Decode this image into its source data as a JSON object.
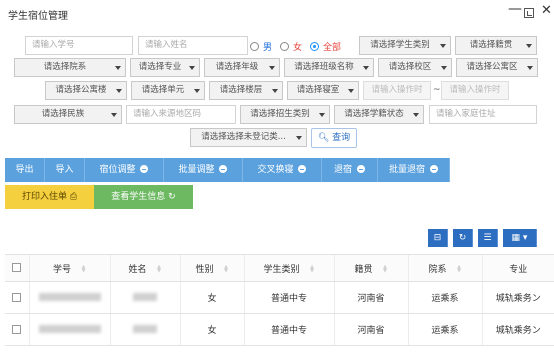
{
  "window": {
    "title": "学生宿位管理",
    "min": "—",
    "close": "✕"
  },
  "filters": {
    "student_no": "请输入学号",
    "name": "请输入姓名",
    "gender_options": [
      "男",
      "女",
      "全部"
    ],
    "gender_selected": "全部",
    "student_type": "请选择学生类别",
    "native": "请选择籍贯",
    "department": "请选择院系",
    "major": "请选择专业",
    "grade": "请选择年级",
    "class_name": "请选择班级名称",
    "campus": "请选择校区",
    "apartment_area": "请选择公寓区",
    "apartment_building": "请选择公寓楼",
    "unit": "请选择单元",
    "floor": "请选择楼层",
    "room": "请选择寝室",
    "op_time_start": "请输入操作时",
    "range_sep": "~",
    "op_time_end": "请输入操作时",
    "ethnicity": "请选择民族",
    "origin_area": "请输入来源地区码",
    "enroll_type": "请选择招生类别",
    "roll_status": "请选择学籍状态",
    "home_address": "请输入家庭住址",
    "unregistered": "请选择选择未登记类...",
    "query_label": "查询"
  },
  "actions": {
    "export": "导出",
    "import": "导入",
    "adjust": "宿位调整",
    "batch_adjust": "批量调整",
    "swap": "交叉换寝",
    "checkout": "退宿",
    "batch_checkout": "批量退宿",
    "print": "打印入住单",
    "view_info": "查看学生信息"
  },
  "table": {
    "columns": [
      "学号",
      "姓名",
      "性别",
      "学生类别",
      "籍贯",
      "院系",
      "专业"
    ],
    "rows": [
      {
        "gender": "女",
        "type": "普通中专",
        "native": "河南省",
        "dept": "运乘系",
        "major": "城轨乘务ン"
      },
      {
        "gender": "女",
        "type": "普通中专",
        "native": "河南省",
        "dept": "运乘系",
        "major": "城轨乘务ン"
      }
    ]
  },
  "colors": {
    "blue": "#5aa1de",
    "yellow": "#f4d03f",
    "green": "#6cb962",
    "tool": "#2d6ec0"
  }
}
